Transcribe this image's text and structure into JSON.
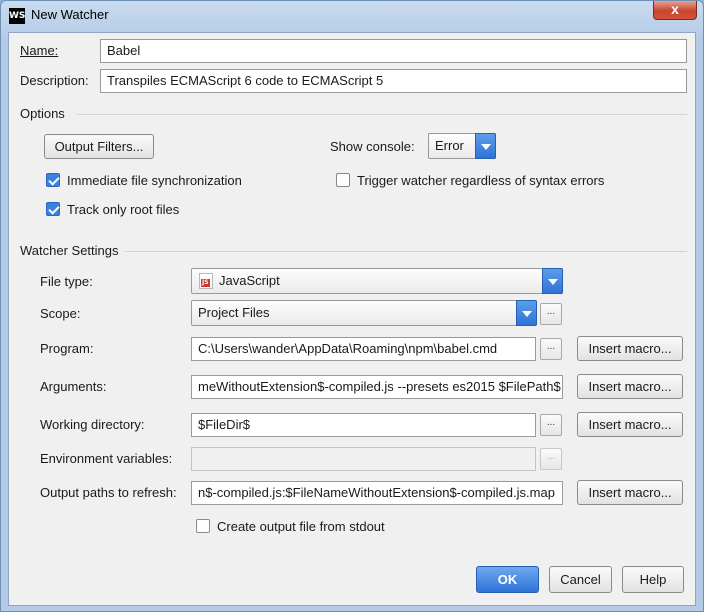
{
  "window": {
    "app_icon": "WS",
    "title": "New Watcher",
    "close_symbol": "x"
  },
  "name": {
    "label": "Name:",
    "value": "Babel"
  },
  "description": {
    "label": "Description:",
    "value": "Transpiles ECMAScript 6 code to ECMAScript 5"
  },
  "options": {
    "section_label": "Options",
    "output_filters_label": "Output Filters...",
    "show_console_label": "Show console:",
    "show_console_value": "Error",
    "immediate_sync": {
      "label": "Immediate file synchronization",
      "checked": true
    },
    "trigger_regardless": {
      "label": "Trigger watcher regardless of syntax errors",
      "checked": false
    },
    "track_root": {
      "label": "Track only root files",
      "checked": true
    }
  },
  "watcher": {
    "section_label": "Watcher Settings",
    "file_type": {
      "label": "File type:",
      "value": "JavaScript",
      "icon": "javascript-file-icon"
    },
    "scope": {
      "label": "Scope:",
      "value": "Project Files"
    },
    "program": {
      "label": "Program:",
      "value": "C:\\Users\\wander\\AppData\\Roaming\\npm\\babel.cmd"
    },
    "arguments": {
      "label": "Arguments:",
      "value": "meWithoutExtension$-compiled.js --presets es2015 $FilePath$"
    },
    "working_dir": {
      "label": "Working directory:",
      "value": "$FileDir$"
    },
    "env_vars": {
      "label": "Environment variables:",
      "value": ""
    },
    "output_paths": {
      "label": "Output paths to refresh:",
      "value": "n$-compiled.js:$FileNameWithoutExtension$-compiled.js.map"
    },
    "insert_macro_label": "Insert macro...",
    "ellipsis_label": "...",
    "create_output": {
      "label": "Create output file from stdout",
      "checked": false
    }
  },
  "footer": {
    "ok_label": "OK",
    "cancel_label": "Cancel",
    "help_label": "Help"
  }
}
